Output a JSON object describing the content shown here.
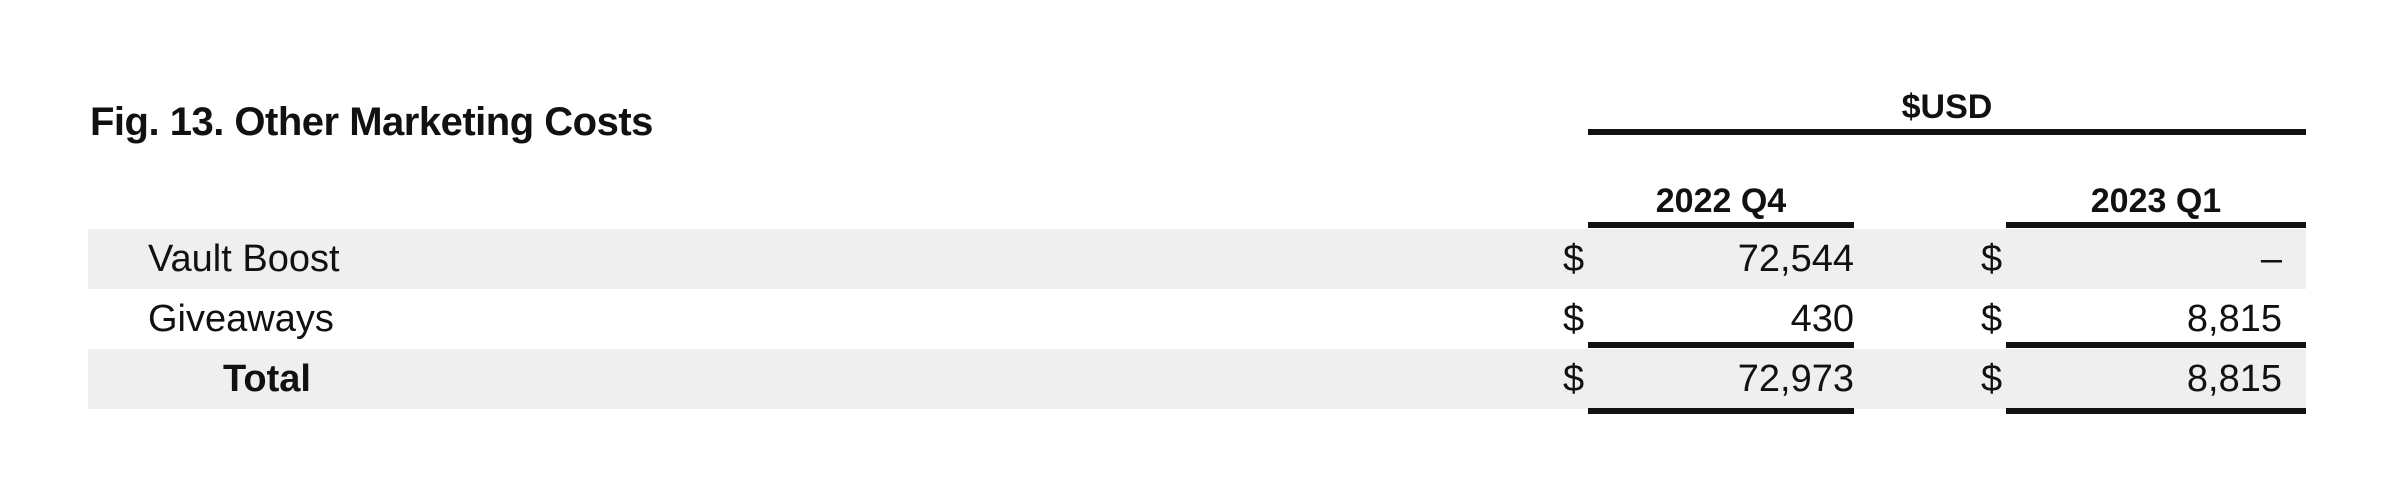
{
  "figure": {
    "title": "Fig. 13. Other Marketing Costs",
    "currency_header": "$USD"
  },
  "columns": [
    "2022 Q4",
    "2023 Q1"
  ],
  "rows": [
    {
      "label": "Vault Boost",
      "currency": "$",
      "q4": "72,544",
      "q1": "–"
    },
    {
      "label": "Giveaways",
      "currency": "$",
      "q4": "430",
      "q1": "8,815"
    },
    {
      "label": "Total",
      "currency": "$",
      "q4": "72,973",
      "q1": "8,815"
    }
  ]
}
